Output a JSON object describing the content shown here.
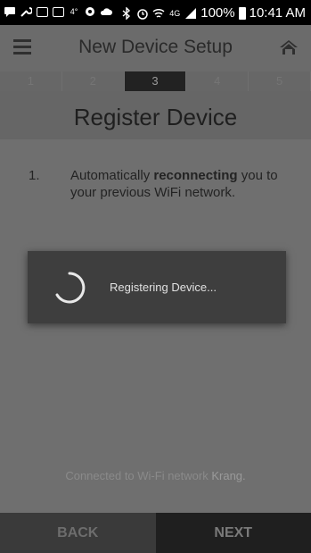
{
  "status_bar": {
    "battery": "100%",
    "time": "10:41 AM",
    "network": "4G",
    "icons_left": [
      "message-icon",
      "wrench-icon",
      "mail-icon",
      "mail-icon",
      "temperature-icon",
      "app-icon",
      "cloud-icon"
    ],
    "icons_right": [
      "bluetooth-icon",
      "alarm-icon",
      "wifi-icon",
      "lte-icon",
      "signal-icon",
      "battery-icon"
    ]
  },
  "header": {
    "title": "New Device Setup",
    "menu_icon": "hamburger-menu-icon",
    "home_icon": "home-icon"
  },
  "steps": {
    "items": [
      "1",
      "2",
      "3",
      "4",
      "5"
    ],
    "active_index": 2
  },
  "section": {
    "title": "Register Device"
  },
  "instructions": {
    "number": "1.",
    "text_before": "Automatically ",
    "text_bold": "reconnecting",
    "text_after": " you to your previous WiFi network."
  },
  "connection": {
    "prefix": "Connected to Wi-Fi network ",
    "network_name": "Krang."
  },
  "footer": {
    "back_label": "BACK",
    "next_label": "NEXT"
  },
  "dialog": {
    "message": "Registering Device..."
  },
  "colors": {
    "background_dim": "#6f6f6f",
    "dialog_bg": "#3e3e3e",
    "active_step": "#222222"
  }
}
